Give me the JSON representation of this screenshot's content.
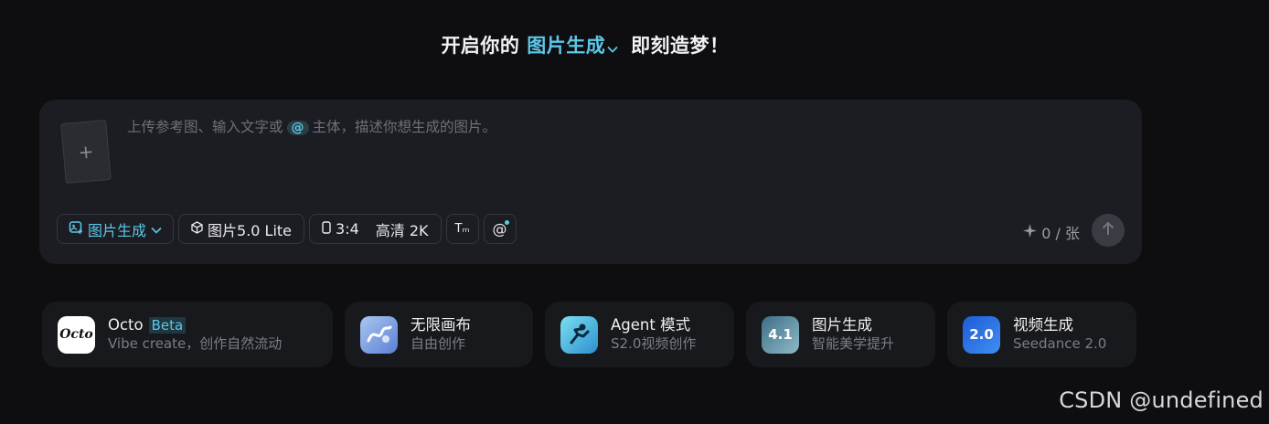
{
  "headline": {
    "prefix": "开启你的",
    "mode": "图片生成",
    "suffix": "即刻造梦！"
  },
  "composer": {
    "placeholder_before": "上传参考图、输入文字或",
    "at_symbol": "@",
    "placeholder_after": "主体，描述你想生成的图片。",
    "upload_symbol": "+"
  },
  "toolbar": {
    "mode_label": "图片生成",
    "model_label": "图片5.0 Lite",
    "ratio_label": "3:4",
    "quality_label": "高清 2K",
    "text_tool_symbol": "Tₘ",
    "mention_symbol": "@"
  },
  "credits": {
    "value": "0 / 张"
  },
  "cards": [
    {
      "title": "Octo",
      "badge": "Beta",
      "subtitle": "Vibe create，创作自然流动",
      "icon": "octo-logo-icon",
      "icon_text": "Octo"
    },
    {
      "title": "无限画布",
      "subtitle": "自由创作",
      "icon": "canvas-icon"
    },
    {
      "title": "Agent 模式",
      "subtitle": "S2.0视频创作",
      "icon": "agent-icon"
    },
    {
      "title": "图片生成",
      "subtitle": "智能美学提升",
      "icon": "image-gen-icon",
      "icon_text": "4.1"
    },
    {
      "title": "视频生成",
      "subtitle": "Seedance 2.0",
      "icon": "video-gen-icon",
      "icon_text": "2.0"
    }
  ],
  "colors": {
    "accent": "#5cc8e8",
    "background": "#0e0e11",
    "panel": "#1c1d22"
  },
  "watermark": "CSDN @undefined"
}
